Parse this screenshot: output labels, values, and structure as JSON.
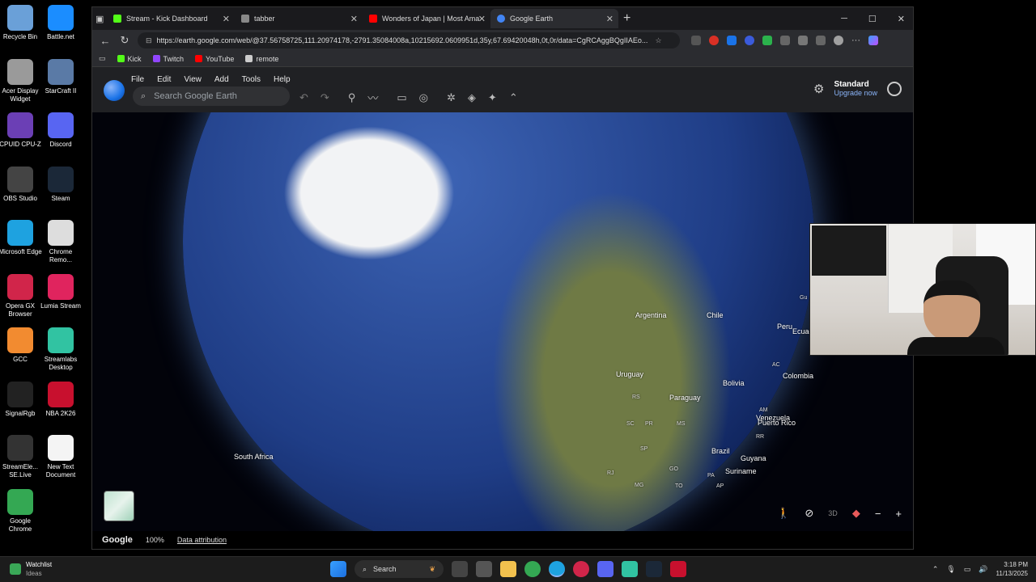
{
  "desktop": {
    "icons": [
      {
        "label": "Recycle Bin",
        "icon": "recycle-bin-icon",
        "color": "#6aa0d8"
      },
      {
        "label": "Battle.net",
        "icon": "battlenet-icon",
        "color": "#1b8dff"
      },
      {
        "label": "Acer Display Widget",
        "icon": "acer-icon",
        "color": "#9a9a9a"
      },
      {
        "label": "StarCraft II",
        "icon": "starcraft-icon",
        "color": "#5a7aa6"
      },
      {
        "label": "CPUID CPU-Z",
        "icon": "cpuz-icon",
        "color": "#6b3fb5"
      },
      {
        "label": "Discord",
        "icon": "discord-icon",
        "color": "#5865f2"
      },
      {
        "label": "OBS Studio",
        "icon": "obs-icon",
        "color": "#444444"
      },
      {
        "label": "Steam",
        "icon": "steam-icon",
        "color": "#1b2838"
      },
      {
        "label": "Microsoft Edge",
        "icon": "edge-icon",
        "color": "#1ea2e0"
      },
      {
        "label": "Chrome Remo...",
        "icon": "chrome-remote-icon",
        "color": "#dddddd"
      },
      {
        "label": "Opera GX Browser",
        "icon": "operagx-icon",
        "color": "#d1254a"
      },
      {
        "label": "Lumia Stream",
        "icon": "lumia-icon",
        "color": "#e0245e"
      },
      {
        "label": "GCC",
        "icon": "gcc-icon",
        "color": "#f28b30"
      },
      {
        "label": "Streamlabs Desktop",
        "icon": "streamlabs-icon",
        "color": "#31c3a2"
      },
      {
        "label": "SignalRgb",
        "icon": "signalrgb-icon",
        "color": "#222222"
      },
      {
        "label": "NBA 2K26",
        "icon": "nba2k-icon",
        "color": "#c8102e"
      },
      {
        "label": "StreamEle... SE.Live",
        "icon": "streamelements-icon",
        "color": "#333333"
      },
      {
        "label": "New Text Document",
        "icon": "text-document-icon",
        "color": "#f4f4f4"
      },
      {
        "label": "Google Chrome",
        "icon": "chrome-icon",
        "color": "#34a853"
      }
    ]
  },
  "browser": {
    "tabs": [
      {
        "label": "Stream - Kick Dashboard",
        "color": "#53fc18"
      },
      {
        "label": "tabber",
        "color": "#888888"
      },
      {
        "label": "Wonders of Japan | Most Amazin",
        "color": "#ff0000"
      },
      {
        "label": "Google Earth",
        "color": "#4285f4"
      }
    ],
    "url": "https://earth.google.com/web/@37.56758725,111.20974178,-2791.35084008a,10215692.0609951d,35y,67.69420048h,0t,0r/data=CgRCAggBQgIIAEo...",
    "bookmarks": [
      {
        "label": "Kick",
        "color": "#53fc18"
      },
      {
        "label": "Twitch",
        "color": "#9146ff"
      },
      {
        "label": "YouTube",
        "color": "#ff0000"
      },
      {
        "label": "remote",
        "color": "#cccccc"
      }
    ]
  },
  "earth": {
    "menu": [
      "File",
      "Edit",
      "View",
      "Add",
      "Tools",
      "Help"
    ],
    "search_placeholder": "Search Google Earth",
    "plan_title": "Standard",
    "plan_action": "Upgrade now",
    "map_labels": [
      {
        "text": "Argentina"
      },
      {
        "text": "Chile"
      },
      {
        "text": "Peru"
      },
      {
        "text": "Ecuador"
      },
      {
        "text": "Uruguay"
      },
      {
        "text": "Bolivia"
      },
      {
        "text": "Colombia"
      },
      {
        "text": "Paraguay"
      },
      {
        "text": "Venezuela"
      },
      {
        "text": "Puerto Rico"
      },
      {
        "text": "Brazil"
      },
      {
        "text": "Guyana"
      },
      {
        "text": "Suriname"
      },
      {
        "text": "South Africa"
      },
      {
        "text": "RS"
      },
      {
        "text": "SC"
      },
      {
        "text": "PR"
      },
      {
        "text": "MS"
      },
      {
        "text": "SP"
      },
      {
        "text": "RJ"
      },
      {
        "text": "GO"
      },
      {
        "text": "MG"
      },
      {
        "text": "TO"
      },
      {
        "text": "PA"
      },
      {
        "text": "AP"
      },
      {
        "text": "AC"
      },
      {
        "text": "AM"
      },
      {
        "text": "RR"
      },
      {
        "text": "Gu"
      }
    ],
    "footer": {
      "brand": "Google",
      "zoom": "100%",
      "attribution": "Data attribution"
    },
    "view_mode": "3D"
  },
  "taskbar": {
    "weather_title": "Watchlist",
    "weather_sub": "Ideas",
    "search_label": "Search",
    "time": "3:18 PM",
    "date": "11/13/2025"
  }
}
